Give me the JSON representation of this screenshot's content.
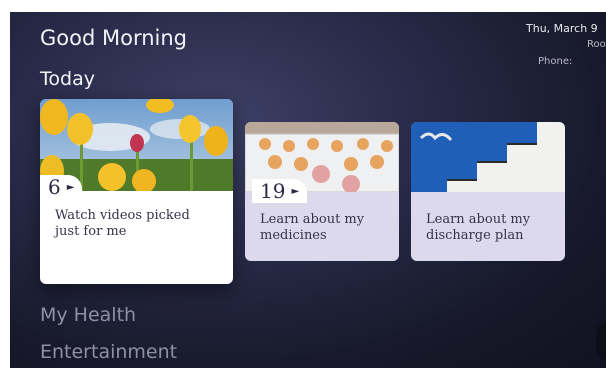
{
  "header": {
    "greeting": "Good Morning",
    "date": "Thu, March 9",
    "room": "Roo",
    "phone_label": "Phone:"
  },
  "section": {
    "title": "Today"
  },
  "cards": [
    {
      "count": "6",
      "title_line1": "Watch videos picked",
      "title_line2": "just for me",
      "image": "tulips"
    },
    {
      "count": "19",
      "title_line1": "Learn about my",
      "title_line2": "medicines",
      "image": "pills"
    },
    {
      "count": "",
      "title_line1": "Learn about my",
      "title_line2": "discharge plan",
      "image": "stairs-and-seagull"
    }
  ],
  "categories": [
    "My Health",
    "Entertainment"
  ],
  "colors": {
    "background": "#1c1d31",
    "card": "#dcd9ec",
    "card_focused": "#ffffff",
    "text": "#34334d",
    "category": "#8f8fa6"
  },
  "icons": {
    "play": "play-arrow-icon"
  }
}
